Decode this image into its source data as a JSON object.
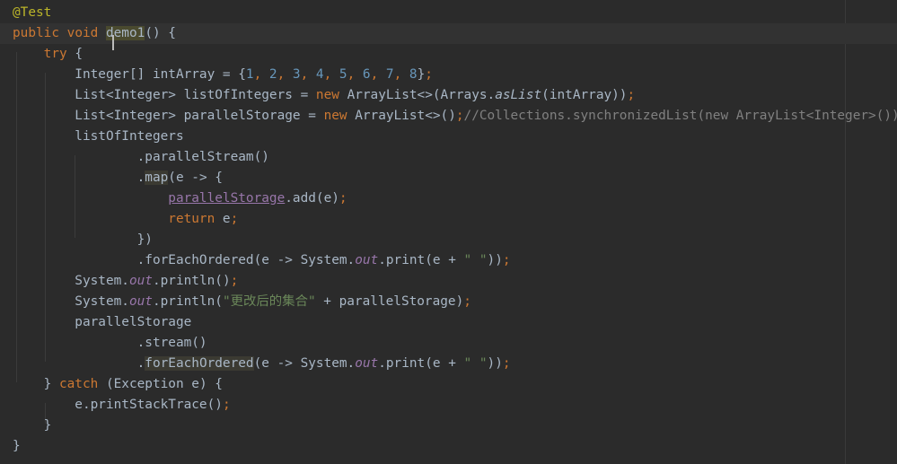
{
  "colors": {
    "background": "#2b2b2b",
    "text": "#a9b7c6",
    "keyword": "#cc7832",
    "annotation": "#bbb529",
    "number": "#6897bb",
    "string": "#6a8759",
    "comment": "#808080",
    "static_field": "#9876aa"
  },
  "lines": [
    {
      "name": "line-annotation",
      "tokens": [
        {
          "t": "@Test",
          "c": "ann"
        }
      ]
    },
    {
      "name": "line-method-signature",
      "current": true,
      "tokens": [
        {
          "t": "public",
          "c": "kw"
        },
        {
          "t": " "
        },
        {
          "t": "void",
          "c": "kw"
        },
        {
          "t": " "
        },
        {
          "t": "demo1",
          "c": "hl-strong",
          "name": "method-name-demo1"
        },
        {
          "t": "() {"
        }
      ]
    },
    {
      "name": "line-try",
      "tokens": [
        {
          "t": "    "
        },
        {
          "t": "try",
          "c": "kw"
        },
        {
          "t": " {"
        }
      ]
    },
    {
      "name": "line-int-array",
      "tokens": [
        {
          "t": "        Integer[] intArray = {"
        },
        {
          "t": "1",
          "c": "num"
        },
        {
          "t": ", ",
          "c": "kw"
        },
        {
          "t": "2",
          "c": "num"
        },
        {
          "t": ", ",
          "c": "kw"
        },
        {
          "t": "3",
          "c": "num"
        },
        {
          "t": ", ",
          "c": "kw"
        },
        {
          "t": "4",
          "c": "num"
        },
        {
          "t": ", ",
          "c": "kw"
        },
        {
          "t": "5",
          "c": "num"
        },
        {
          "t": ", ",
          "c": "kw"
        },
        {
          "t": "6",
          "c": "num"
        },
        {
          "t": ", ",
          "c": "kw"
        },
        {
          "t": "7",
          "c": "num"
        },
        {
          "t": ", ",
          "c": "kw"
        },
        {
          "t": "8",
          "c": "num"
        },
        {
          "t": "}"
        },
        {
          "t": ";",
          "c": "kw"
        }
      ]
    },
    {
      "name": "line-list-of-integers",
      "tokens": [
        {
          "t": "        List<Integer> listOfIntegers = "
        },
        {
          "t": "new",
          "c": "kw"
        },
        {
          "t": " ArrayList<>(Arrays."
        },
        {
          "t": "asList",
          "c": "static-method"
        },
        {
          "t": "(intArray))"
        },
        {
          "t": ";",
          "c": "kw"
        }
      ]
    },
    {
      "name": "line-parallel-storage",
      "tokens": [
        {
          "t": "        List<Integer> parallelStorage = "
        },
        {
          "t": "new",
          "c": "kw"
        },
        {
          "t": " ArrayList<>()"
        },
        {
          "t": ";",
          "c": "kw"
        },
        {
          "t": "//Collections.synchronizedList(new ArrayList<Integer>()); //",
          "c": "cmt"
        }
      ]
    },
    {
      "name": "line-list-of-integers-ref",
      "tokens": [
        {
          "t": "        listOfIntegers"
        }
      ]
    },
    {
      "name": "line-parallel-stream",
      "tokens": [
        {
          "t": "                .parallelStream()"
        }
      ]
    },
    {
      "name": "line-map",
      "tokens": [
        {
          "t": "                ."
        },
        {
          "t": "map",
          "c": "hl",
          "name": "method-map"
        },
        {
          "t": "(e -> {"
        }
      ]
    },
    {
      "name": "line-storage-add",
      "tokens": [
        {
          "t": "                    "
        },
        {
          "t": "parallelStorage",
          "c": "field-ul",
          "name": "captured-var-parallel-storage"
        },
        {
          "t": ".add(e)"
        },
        {
          "t": ";",
          "c": "kw"
        }
      ]
    },
    {
      "name": "line-return",
      "tokens": [
        {
          "t": "                    "
        },
        {
          "t": "return",
          "c": "kw"
        },
        {
          "t": " e"
        },
        {
          "t": ";",
          "c": "kw"
        }
      ]
    },
    {
      "name": "line-close-lambda",
      "tokens": [
        {
          "t": "                })"
        }
      ]
    },
    {
      "name": "line-for-each-ordered-1",
      "tokens": [
        {
          "t": "                .forEachOrdered(e -> System."
        },
        {
          "t": "out",
          "c": "static-field"
        },
        {
          "t": ".print(e + "
        },
        {
          "t": "\" \"",
          "c": "str"
        },
        {
          "t": "))"
        },
        {
          "t": ";",
          "c": "kw"
        }
      ]
    },
    {
      "name": "line-println-empty",
      "tokens": [
        {
          "t": "        System."
        },
        {
          "t": "out",
          "c": "static-field"
        },
        {
          "t": ".println()"
        },
        {
          "t": ";",
          "c": "kw"
        }
      ]
    },
    {
      "name": "line-println-collection",
      "tokens": [
        {
          "t": "        System."
        },
        {
          "t": "out",
          "c": "static-field"
        },
        {
          "t": ".println("
        },
        {
          "t": "\"更改后的集合\"",
          "c": "str"
        },
        {
          "t": " + parallelStorage)"
        },
        {
          "t": ";",
          "c": "kw"
        }
      ]
    },
    {
      "name": "line-parallel-storage-ref",
      "tokens": [
        {
          "t": "        parallelStorage"
        }
      ]
    },
    {
      "name": "line-stream",
      "tokens": [
        {
          "t": "                .stream()"
        }
      ]
    },
    {
      "name": "line-for-each-ordered-2",
      "tokens": [
        {
          "t": "                ."
        },
        {
          "t": "forEachOrdered",
          "c": "hl",
          "name": "method-for-each-ordered"
        },
        {
          "t": "(e -> System."
        },
        {
          "t": "out",
          "c": "static-field"
        },
        {
          "t": ".print(e + "
        },
        {
          "t": "\" \"",
          "c": "str"
        },
        {
          "t": "))"
        },
        {
          "t": ";",
          "c": "kw"
        }
      ]
    },
    {
      "name": "line-catch",
      "tokens": [
        {
          "t": "    } "
        },
        {
          "t": "catch",
          "c": "kw"
        },
        {
          "t": " (Exception e) {"
        }
      ]
    },
    {
      "name": "line-print-stack-trace",
      "tokens": [
        {
          "t": "        e.printStackTrace()"
        },
        {
          "t": ";",
          "c": "kw"
        }
      ]
    },
    {
      "name": "line-close-catch",
      "tokens": [
        {
          "t": "    }"
        }
      ]
    },
    {
      "name": "line-close-method",
      "tokens": [
        {
          "t": "}"
        }
      ]
    }
  ]
}
